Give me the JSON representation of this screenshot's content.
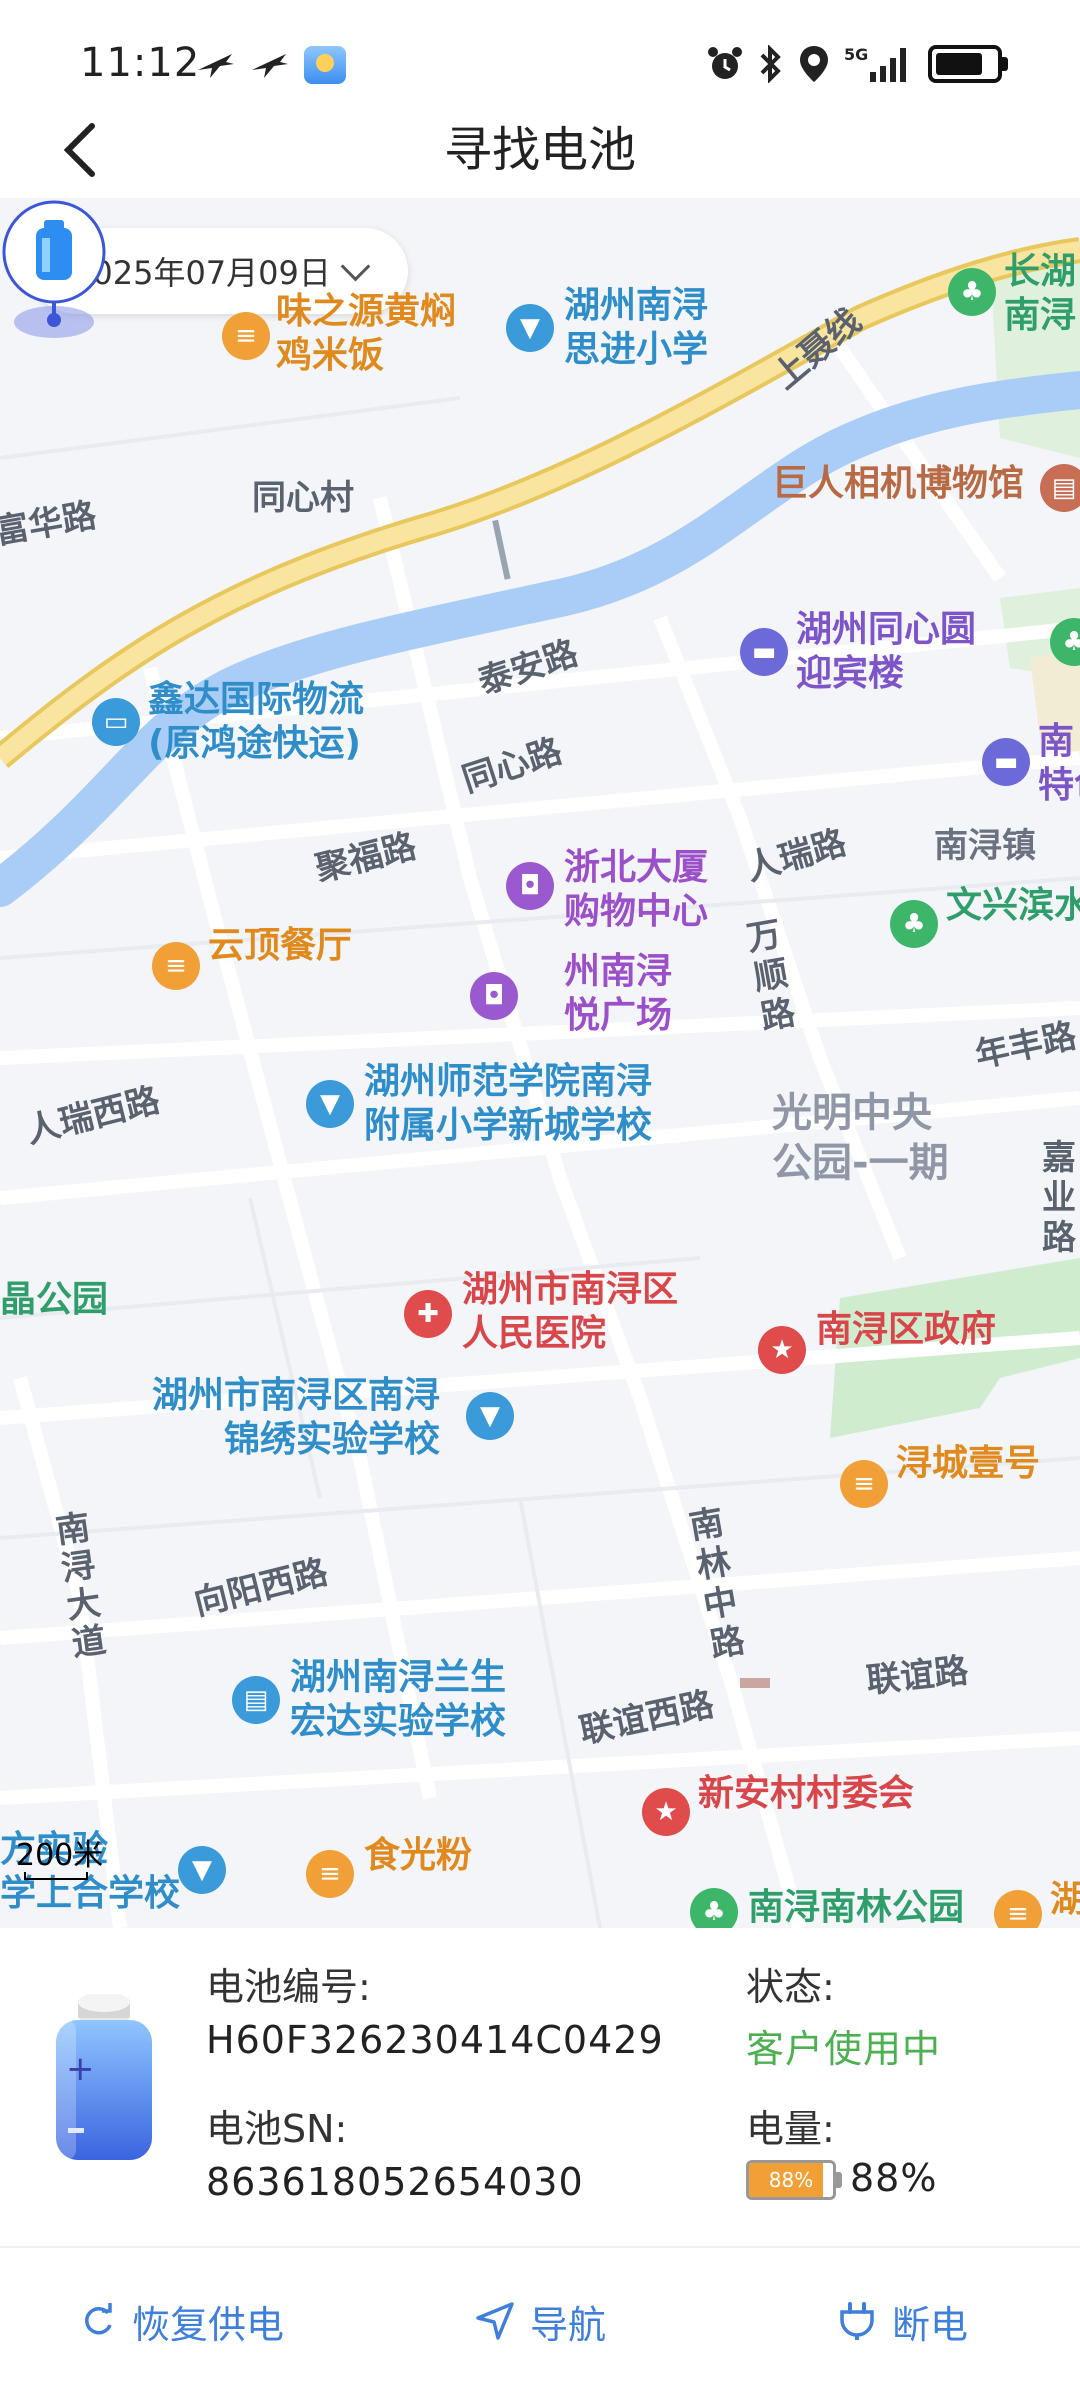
{
  "status_bar": {
    "time": "11:12",
    "icons_left": [
      "airplane-icon",
      "airplane-icon",
      "weather-app-icon"
    ],
    "icons_right": [
      "alarm-icon",
      "bluetooth-icon",
      "location-icon",
      "signal-5g-icon",
      "battery-icon"
    ],
    "network": "5G"
  },
  "header": {
    "title": "寻找电池",
    "back_icon": "chevron-left-icon"
  },
  "map": {
    "date_selector": "2025年07月09日",
    "scale": "200米",
    "pois": {
      "p1": "味之源黄焖\n鸡米饭",
      "p2": "湖州南浔\n思进小学",
      "p3": "长湖\n南浔",
      "p4": "巨人相机博物馆",
      "p5": "湖州同心圆\n迎宾楼",
      "p6": "鑫达国际物流\n(原鸿途快运)",
      "p7": "南\n特色",
      "p8": "浙北大厦\n购物中心",
      "p9": "南浔镇",
      "p10": "文兴滨水",
      "p11": "云顶餐厅",
      "p12": "州南浔\n悦广场",
      "p13": "湖州师范学院南浔\n附属小学新城学校",
      "p14": "光明中央\n公园-一期",
      "p15": "湖州市南浔区\n人民医院",
      "p16": "晶公园",
      "p17": "南浔区政府",
      "p18": "湖州市南浔区南浔\n锦绣实验学校",
      "p19": "浔城壹号",
      "p20": "湖州南浔兰生\n宏达实验学校",
      "p21": "新安村村委会",
      "p22": "食光粉",
      "p23": "方实验\n学上合学校",
      "p24": "南浔南林公园",
      "p25": "湖"
    },
    "roads": {
      "r1": "上聂线",
      "r2": "同心村",
      "r3": "富华路",
      "r4": "泰安路",
      "r5": "同心路",
      "r6": "聚福路",
      "r7": "人瑞路",
      "r8": "万\n顺\n路",
      "r9": "年丰路",
      "r10": "人瑞西路",
      "r11": "嘉\n业\n路",
      "r12": "南\n浔\n大\n道",
      "r13": "向阳西路",
      "r14": "南\n林\n中\n路",
      "r15": "联谊路",
      "r16": "联谊西路"
    }
  },
  "battery_info": {
    "number_label": "电池编号:",
    "number_value": "H60F326230414C0429",
    "sn_label": "电池SN:",
    "sn_value": "863618052654030",
    "status_label": "状态:",
    "status_value": "客户使用中",
    "charge_label": "电量:",
    "charge_badge": "88%",
    "charge_value": "88%",
    "charge_fraction": 0.88,
    "status_color": "#4caf50"
  },
  "actions": {
    "restore": "恢复供电",
    "navigate": "导航",
    "cut": "断电"
  },
  "colors": {
    "accent": "#3f7fdc",
    "river": "#a9cdf7",
    "highway": "#f7dc8a"
  }
}
